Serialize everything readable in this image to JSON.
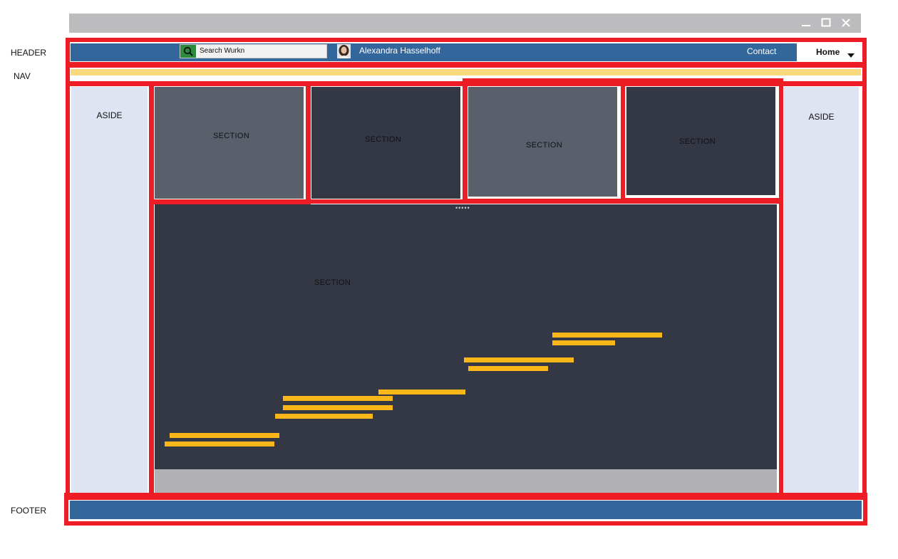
{
  "labels": {
    "header": "HEADER",
    "nav": "NAV",
    "footer": "FOOTER",
    "aside_left": "ASIDE",
    "aside_right": "ASIDE"
  },
  "window": {
    "minimize_icon": "minimize-icon",
    "maximize_icon": "maximize-icon",
    "close_icon": "close-icon"
  },
  "header": {
    "search_placeholder": "Search Wurkn",
    "user_name": "Alexandra Hasselhoff",
    "contact_label": "Contact",
    "home_label": "Home"
  },
  "sections": {
    "top": [
      "SECTION",
      "SECTION",
      "SECTION",
      "SECTION"
    ],
    "main": "SECTION",
    "drag_handle": "•••••"
  },
  "colors": {
    "header_blue": "#33669a",
    "outline_red": "#ee1c25",
    "nav_yellow": "#f8d97c",
    "bar_orange": "#fbb71a",
    "aside_bg": "#dfe4f2",
    "section_dark": "#333844",
    "section_light": "#5a606b"
  }
}
